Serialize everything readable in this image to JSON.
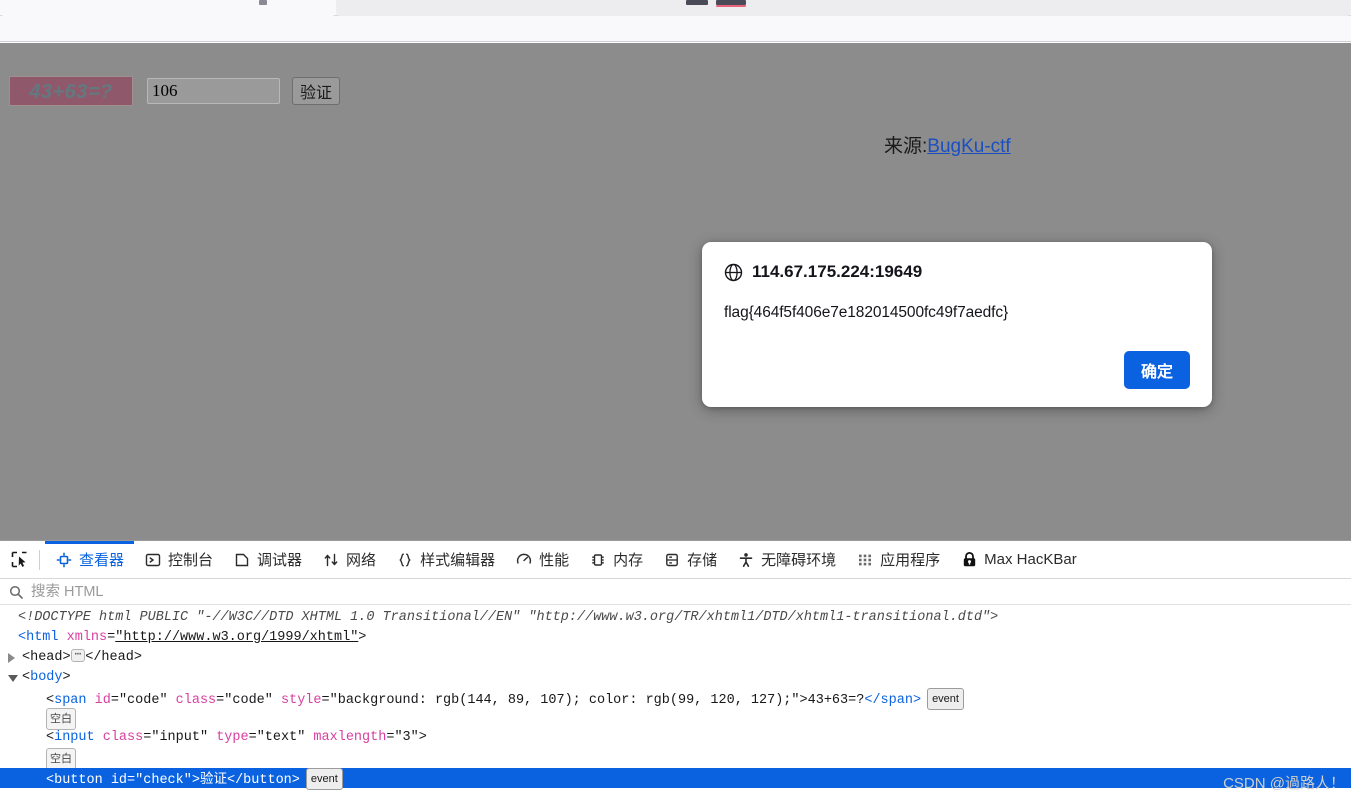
{
  "page": {
    "captcha": {
      "question": "43+63=?",
      "bg_color": "#90596b",
      "text_color": "#63787f",
      "answer_value": "106",
      "answer_maxlength": "3",
      "verify_label": "验证"
    },
    "source_prefix": "来源:",
    "source_link_label": "BugKu-ctf"
  },
  "dialog": {
    "origin": "114.67.175.224:19649",
    "message": "flag{464f5f406e7e182014500fc49f7aedfc}",
    "ok_label": "确定",
    "accent_color": "#0a62e0"
  },
  "devtools": {
    "picker_icon": "element-picker-icon",
    "tabs": [
      {
        "label": "查看器",
        "icon": "inspector-icon",
        "active": true
      },
      {
        "label": "控制台",
        "icon": "console-icon",
        "active": false
      },
      {
        "label": "调试器",
        "icon": "debugger-icon",
        "active": false
      },
      {
        "label": "网络",
        "icon": "network-icon",
        "active": false
      },
      {
        "label": "样式编辑器",
        "icon": "style-editor-icon",
        "active": false
      },
      {
        "label": "性能",
        "icon": "performance-icon",
        "active": false
      },
      {
        "label": "内存",
        "icon": "memory-icon",
        "active": false
      },
      {
        "label": "存储",
        "icon": "storage-icon",
        "active": false
      },
      {
        "label": "无障碍环境",
        "icon": "accessibility-icon",
        "active": false
      },
      {
        "label": "应用程序",
        "icon": "application-icon",
        "active": false
      },
      {
        "label": "Max HacKBar",
        "icon": "hackbar-lock-icon",
        "active": false
      }
    ],
    "search_placeholder": "搜索 HTML",
    "markup": {
      "doctype": "<!DOCTYPE html PUBLIC \"-//W3C//DTD XHTML 1.0 Transitional//EN\" \"http://www.w3.org/TR/xhtml1/DTD/xhtml1-transitional.dtd\">",
      "html_tag_open": "<html",
      "html_attr_name": "xmlns",
      "html_attr_value": "\"http://www.w3.org/1999/xhtml\"",
      "html_tag_close": ">",
      "head_open": "<head>",
      "head_ellipsis": "…",
      "head_close": "</head>",
      "body_open": "<body>",
      "span_open": "<span",
      "span_attr_id_name": "id",
      "span_attr_id_value": "\"code\"",
      "span_attr_class_name": "class",
      "span_attr_class_value": "\"code\"",
      "span_attr_style_name": "style",
      "span_attr_style_value": "\"background: rgb(144, 89, 107); color: rgb(99, 120, 127);\"",
      "span_gt": ">",
      "span_text": "43+63=?",
      "span_close": "</span>",
      "span_badge": "event",
      "whitespace_badge": "空白",
      "input_open": "<input",
      "input_attr_class_name": "class",
      "input_attr_class_value": "\"input\"",
      "input_attr_type_name": "type",
      "input_attr_type_value": "\"text\"",
      "input_attr_maxlength_name": "maxlength",
      "input_attr_maxlength_value": "\"3\"",
      "input_gt": ">",
      "button_open": "<button",
      "button_attr_id_name": "id",
      "button_attr_id_value": "\"check\"",
      "button_gt": ">",
      "button_text": "验证",
      "button_close": "</button>",
      "button_badge": "event"
    }
  },
  "watermark": "CSDN @過路人！"
}
